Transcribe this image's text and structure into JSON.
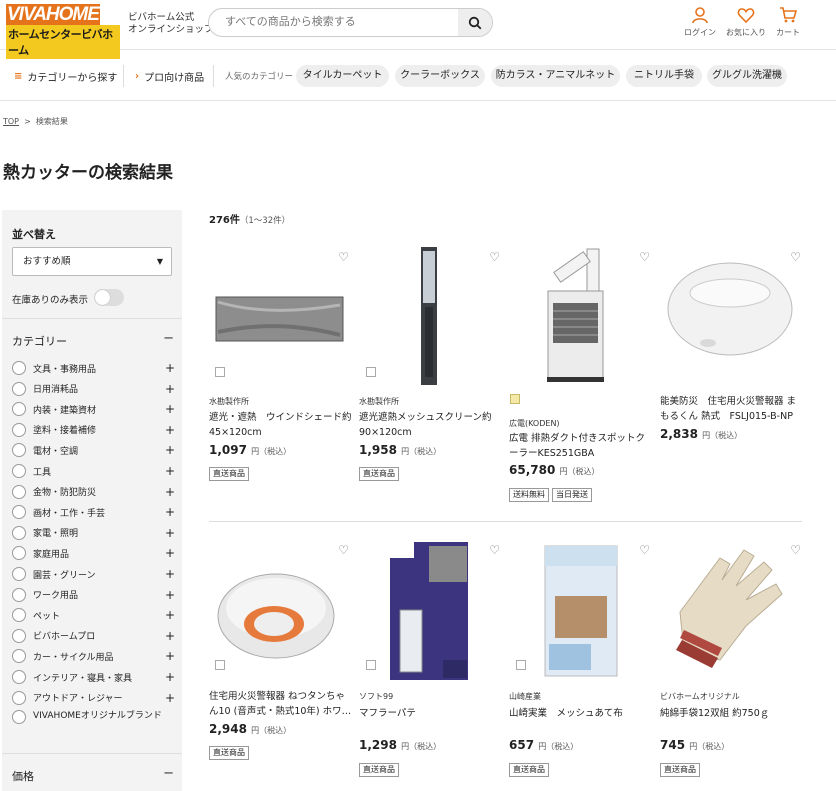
{
  "header": {
    "logo_top": "VIVAHOME",
    "logo_bottom": "ホームセンタービバホーム",
    "shop_line1": "ビバホーム公式",
    "shop_line2": "オンラインショップ",
    "search_placeholder": "すべての商品から検索する",
    "login": "ログイン",
    "favorites": "お気に入り",
    "cart": "カート",
    "accent": "#e5731b"
  },
  "nav": {
    "category": "カテゴリーから探す",
    "pro": "プロ向け商品",
    "popular_label": "人気のカテゴリー",
    "chips": [
      "タイルカーペット",
      "クーラーボックス",
      "防カラス・アニマルネット",
      "ニトリル手袋",
      "グルグル洗濯機"
    ]
  },
  "breadcrumb": {
    "top": "TOP",
    "sep": ">",
    "current": "検索結果"
  },
  "page_title": "熱カッターの検索結果",
  "sidebar": {
    "sort_title": "並べ替え",
    "sort_value": "おすすめ順",
    "stock_label": "在庫ありのみ表示",
    "category_title": "カテゴリー",
    "categories": [
      "文具・事務用品",
      "日用消耗品",
      "内装・建築資材",
      "塗料・接着補修",
      "電材・空調",
      "工具",
      "金物・防犯防災",
      "画材・工作・手芸",
      "家電・照明",
      "家庭用品",
      "園芸・グリーン",
      "ワーク用品",
      "ペット",
      "ビバホームプロ",
      "カー・サイクル用品",
      "インテリア・寝具・家具",
      "アウトドア・レジャー",
      "VIVAHOMEオリジナルブランド"
    ],
    "price_title": "価格"
  },
  "results": {
    "count": "276件",
    "range": "（1～32件）",
    "tax_label": "円（税込）",
    "products": [
      {
        "maker": "水勘製作所",
        "name": "遮光・遮熱　ウインドシェード約45×120cm",
        "price": "1,097",
        "tags": [
          "直送商品"
        ]
      },
      {
        "maker": "水勘製作所",
        "name": "遮光遮熱メッシュスクリーン約90×120cm",
        "price": "1,958",
        "tags": [
          "直送商品"
        ]
      },
      {
        "maker": "広電(KODEN)",
        "name": "広電 排熱ダクト付きスポットクーラーKES251GBA",
        "price": "65,780",
        "tags": [
          "送料無料",
          "当日発送"
        ]
      },
      {
        "maker": "",
        "name": "能美防災　住宅用火災警報器 まもるくん 熱式　FSLJ015-B-NP",
        "price": "2,838",
        "tags": []
      },
      {
        "maker": "",
        "name": "住宅用火災警報器 ねつタンちゃん10 (音声式・熱式10年) ホワ…",
        "price": "2,948",
        "tags": [
          "直送商品"
        ]
      },
      {
        "maker": "ソフト99",
        "name": "マフラーパテ",
        "price": "1,298",
        "tags": [
          "直送商品"
        ]
      },
      {
        "maker": "山崎産業",
        "name": "山崎実業　メッシュあて布",
        "price": "657",
        "tags": [
          "直送商品"
        ]
      },
      {
        "maker": "ビバホームオリジナル",
        "name": "純綿手袋12双組 約750ｇ",
        "price": "745",
        "tags": [
          "直送商品"
        ]
      }
    ]
  }
}
